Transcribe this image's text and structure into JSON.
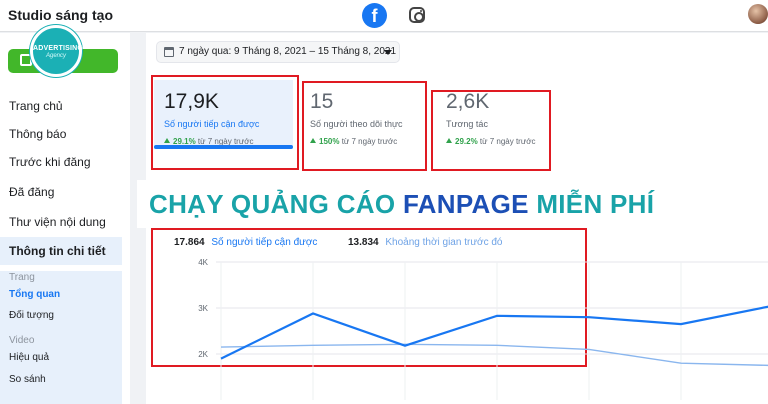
{
  "app": {
    "title": "Studio sáng tạo"
  },
  "icons": {
    "facebook": "facebook-icon",
    "instagram": "instagram-icon"
  },
  "logo": {
    "line1": "ADVERTISING",
    "line2": "Agency"
  },
  "sidebar": {
    "items": [
      {
        "label": "Trang chủ"
      },
      {
        "label": "Thông báo"
      },
      {
        "label": "Trước khi đăng"
      },
      {
        "label": "Đã đăng"
      },
      {
        "label": "Thư viện nội dung"
      },
      {
        "label": "Thông tin chi tiết"
      }
    ],
    "sections": [
      {
        "heading": "Trang",
        "items": [
          "Tổng quan",
          "Đối tượng"
        ]
      },
      {
        "heading": "Video",
        "items": [
          "Hiệu quả",
          "So sánh"
        ]
      }
    ]
  },
  "date_range": {
    "label": "7 ngày qua: 9 Tháng 8, 2021 – 15 Tháng 8, 2021"
  },
  "metrics": [
    {
      "value": "17,9K",
      "label": "Số người tiếp cận được",
      "change": "29.1%",
      "suffix": " từ 7 ngày trước"
    },
    {
      "value": "15",
      "label": "Số người theo dõi thực",
      "change": "150%",
      "suffix": " từ 7 ngày trước"
    },
    {
      "value": "2,6K",
      "label": "Tương tác",
      "change": "29.2%",
      "suffix": " từ 7 ngày trước"
    }
  ],
  "banner": {
    "part1": "CHẠY QUẢNG CÁO ",
    "part2": "FANPAGE",
    "part3": " MIỄN PHÍ"
  },
  "colors": {
    "accent": "#1877f2",
    "positive": "#31a24c",
    "highlight": "#e01a22",
    "banner_teal": "#19a3a8",
    "banner_blue": "#1c4fb5"
  },
  "chart_data": {
    "type": "line",
    "legend": [
      {
        "value": "17.864",
        "name": "Số người tiếp cận được",
        "color": "#1877f2"
      },
      {
        "value": "13.834",
        "name": "Khoảng thời gian trước đó",
        "color": "#8ab6ee"
      }
    ],
    "y_ticks": [
      "4K",
      "3K",
      "2K"
    ],
    "ylim": [
      1000,
      4000
    ],
    "series": [
      {
        "name": "Số người tiếp cận được",
        "color": "#1877f2",
        "values": [
          1900,
          2880,
          2180,
          2830,
          2800,
          2650,
          3050
        ]
      },
      {
        "name": "Khoảng thời gian trước đó",
        "color": "#8ab6ee",
        "values": [
          2150,
          2190,
          2210,
          2190,
          2100,
          1800,
          1750
        ]
      }
    ]
  }
}
